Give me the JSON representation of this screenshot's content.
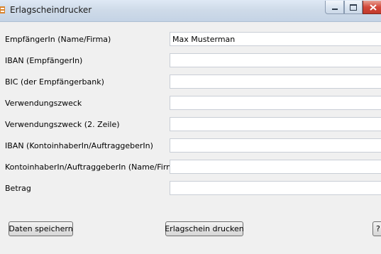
{
  "window": {
    "title": "Erlagscheindrucker",
    "controls": {
      "minimize": "minimize",
      "maximize": "maximize",
      "close": "close"
    }
  },
  "form": {
    "fields": [
      {
        "label": "EmpfängerIn (Name/Firma)",
        "value": "Max Musterman"
      },
      {
        "label": "IBAN (EmpfängerIn)",
        "value": ""
      },
      {
        "label": "BIC (der Empfängerbank)",
        "value": ""
      },
      {
        "label": "Verwendungszweck",
        "value": ""
      },
      {
        "label": "Verwendungszweck (2. Zeile)",
        "value": ""
      },
      {
        "label": "IBAN (KontoinhaberIn/AuftraggeberIn)",
        "value": ""
      },
      {
        "label": "KontoinhaberIn/AuftraggeberIn (Name/Firma)",
        "value": ""
      },
      {
        "label": "Betrag",
        "value": ""
      }
    ]
  },
  "buttons": {
    "save_label": "Daten speichern",
    "print_label": "Erlagschein drucken",
    "help_label": "?"
  },
  "colors": {
    "window_bg": "#f0f0f0",
    "titlebar": "#c4d3e5",
    "close_button": "#c8473a"
  }
}
